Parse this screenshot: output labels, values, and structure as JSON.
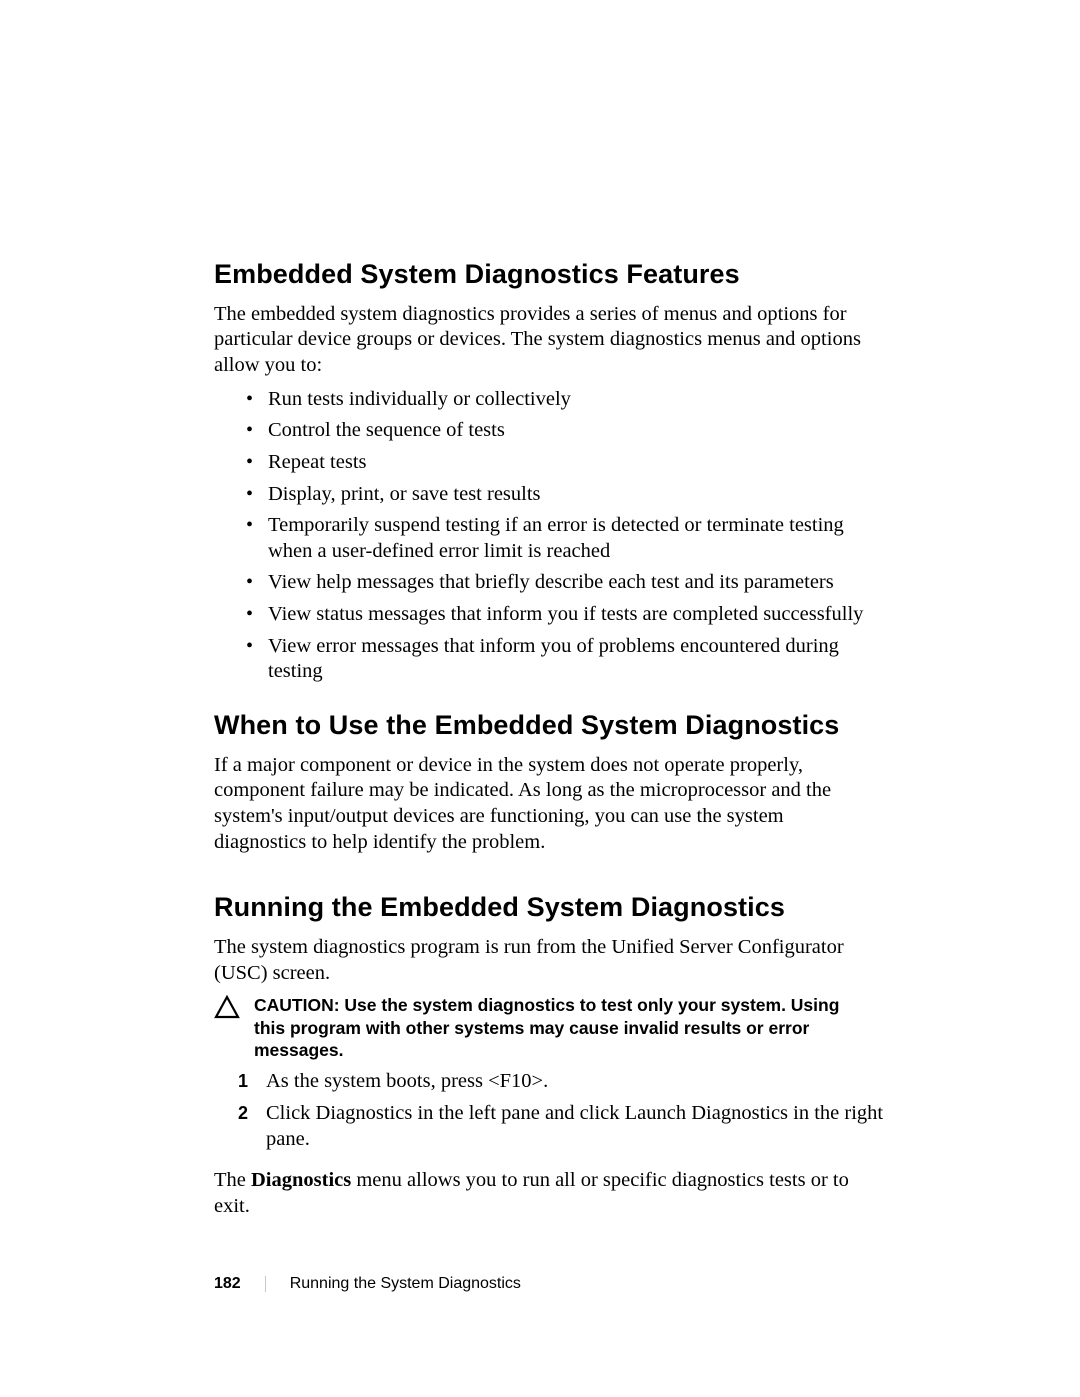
{
  "section1": {
    "title": "Embedded System Diagnostics Features",
    "intro": "The embedded system diagnostics provides a series of menus and options for particular device groups or devices. The system diagnostics menus and options allow you to:",
    "bullets": [
      "Run tests individually or collectively",
      "Control the sequence of tests",
      "Repeat tests",
      "Display, print, or save test results",
      "Temporarily suspend testing if an error is detected or terminate testing when a user-defined error limit is reached",
      "View help messages that briefly describe each test and its parameters",
      "View status messages that inform you if tests are completed successfully",
      "View error messages that inform you of problems encountered during testing"
    ]
  },
  "section2": {
    "title": "When to Use the Embedded System Diagnostics",
    "body": "If a major component or device in the system does not operate properly, component failure may be indicated. As long as the microprocessor and the system's input/output devices are functioning, you can use the system diagnostics to help identify the problem."
  },
  "section3": {
    "title": "Running the Embedded System Diagnostics",
    "intro": "The system diagnostics program is run from the Unified Server Configurator (USC) screen.",
    "caution_lead": "CAUTION: ",
    "caution_body": "Use the system diagnostics to test only your system. Using this program with other systems may cause invalid results or error messages.",
    "steps": [
      "As the system boots, press <F10>.",
      "Click Diagnostics in the left pane and click Launch Diagnostics in the right pane."
    ],
    "closing_pre": "The ",
    "closing_bold": "Diagnostics",
    "closing_post": " menu allows you to run all or specific diagnostics tests or to exit."
  },
  "footer": {
    "page": "182",
    "title": "Running the System Diagnostics"
  }
}
